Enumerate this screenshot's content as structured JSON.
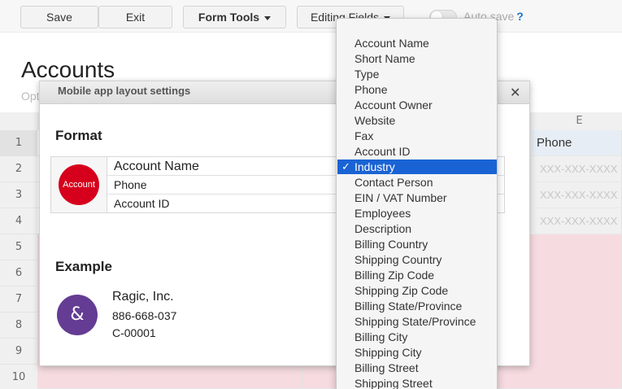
{
  "toolbar": {
    "save_label": "Save",
    "exit_label": "Exit",
    "form_tools_label": "Form Tools",
    "editing_fields_label": "Editing Fields",
    "auto_save_label": "Auto save",
    "help_label": "?"
  },
  "page": {
    "title": "Accounts",
    "subtitle": "Opt"
  },
  "sheet": {
    "column_e_header": "E",
    "rows": [
      "1",
      "2",
      "3",
      "4",
      "5",
      "6",
      "7",
      "8",
      "9",
      "10"
    ],
    "phone_header": "Phone",
    "phone_placeholder": "XXX-XXX-XXXX"
  },
  "modal": {
    "title": "Mobile app layout settings",
    "close_label": "✕",
    "format_heading": "Format",
    "avatar_label": "Account",
    "format_rows": [
      "Account Name",
      "Phone",
      "Account ID"
    ],
    "example_heading": "Example",
    "example_avatar": "&",
    "example_lines": [
      "Ragic, Inc.",
      "886-668-037",
      "C-00001"
    ]
  },
  "dropdown": {
    "selected": "Industry",
    "check": "✓",
    "options": [
      "Account Name",
      "Short Name",
      "Type",
      "Phone",
      "Account Owner",
      "Website",
      "Fax",
      "Account ID",
      "Industry",
      "Contact Person",
      "EIN / VAT Number",
      "Employees",
      "Description",
      "Billing Country",
      "Shipping Country",
      "Billing Zip Code",
      "Shipping Zip Code",
      "Billing State/Province",
      "Shipping State/Province",
      "Billing City",
      "Shipping City",
      "Billing Street",
      "Shipping Street"
    ]
  },
  "colors": {
    "format_avatar": "#d6001c",
    "example_avatar": "#653c94",
    "selected_option": "#1a63d4",
    "sheet_pink": "#f6dce0"
  }
}
